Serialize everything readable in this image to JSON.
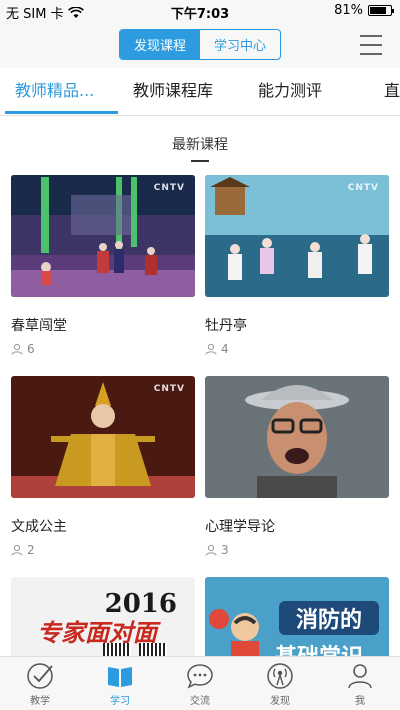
{
  "status_bar": {
    "carrier": "无 SIM 卡",
    "time": "下午7:03",
    "battery": "81%",
    "battery_level": 0.81
  },
  "nav": {
    "segments": [
      "发现课程",
      "学习中心"
    ],
    "active_segment": 0
  },
  "tabs": {
    "items": [
      "教师精品...",
      "教师课程库",
      "能力测评",
      "直"
    ],
    "active": 0
  },
  "section": {
    "title": "最新课程"
  },
  "courses": [
    {
      "title": "春草闯堂",
      "count": "6"
    },
    {
      "title": "牡丹亭",
      "count": "4"
    },
    {
      "title": "文成公主",
      "count": "2"
    },
    {
      "title": "心理学导论",
      "count": "3"
    },
    {
      "title": "",
      "count": ""
    },
    {
      "title": "",
      "count": ""
    }
  ],
  "thumb_texts": {
    "logo": "CNTV",
    "year": "2016",
    "expert": "专家面对面",
    "fire": "消防的",
    "fire2": "基础常识"
  },
  "tabbar": {
    "items": [
      {
        "label": "教学",
        "icon": "check-circle-icon"
      },
      {
        "label": "学习",
        "icon": "book-icon"
      },
      {
        "label": "交流",
        "icon": "chat-icon"
      },
      {
        "label": "发现",
        "icon": "broadcast-icon"
      },
      {
        "label": "我",
        "icon": "person-icon"
      }
    ],
    "active": 1
  },
  "colors": {
    "accent": "#2d9bdf"
  }
}
